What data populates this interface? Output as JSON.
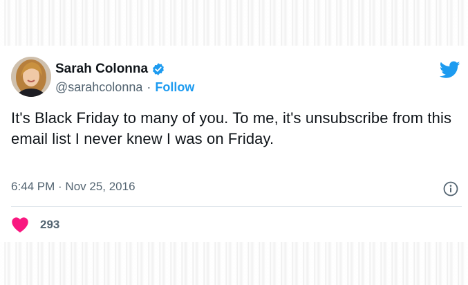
{
  "tweet": {
    "author": {
      "display_name": "Sarah Colonna",
      "handle": "@sarahcolonna",
      "verified": true
    },
    "separator": "·",
    "follow_label": "Follow",
    "text": "It's Black Friday to many of you. To me, it's unsubscribe from this email list I never knew I was on Friday.",
    "timestamp": "6:44 PM · Nov 25, 2016",
    "likes": "293"
  },
  "colors": {
    "accent": "#1d9bf0",
    "heart": "#f91880",
    "text_primary": "#0f1419",
    "text_secondary": "#536471"
  },
  "icons": [
    "verified-badge-icon",
    "twitter-bird-icon",
    "info-icon",
    "heart-icon"
  ]
}
